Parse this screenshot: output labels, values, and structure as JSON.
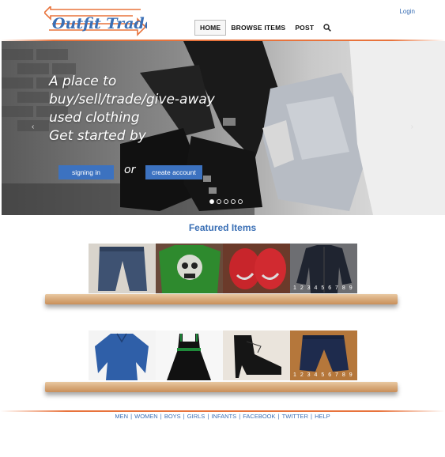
{
  "header": {
    "logo_text": "Outfit Trader",
    "nav": [
      "HOME",
      "BROWSE ITEMS",
      "POST"
    ],
    "login": "Login"
  },
  "hero": {
    "lines": [
      "A place to",
      "buy/sell/trade/give-away",
      "used clothing",
      "Get started by"
    ],
    "signin_label": "signing in",
    "or_text": "or",
    "create_label": "create account",
    "slide_count": 5,
    "active_slide": 0
  },
  "featured": {
    "title": "Featured Items",
    "row1": [
      {
        "name": "jeans",
        "icon": "jeans"
      },
      {
        "name": "green skull shirt",
        "icon": "skull-shirt"
      },
      {
        "name": "red sneakers",
        "icon": "sneakers"
      },
      {
        "name": "black jacket",
        "icon": "jacket",
        "pager": "1 2 3 4 5 6 7 8 9"
      }
    ],
    "row2": [
      {
        "name": "blue blouse",
        "icon": "blouse"
      },
      {
        "name": "black dress",
        "icon": "dress"
      },
      {
        "name": "black booties",
        "icon": "booties"
      },
      {
        "name": "capri jeans",
        "icon": "capris",
        "pager": "1 2 3 4 5 6 7 8 9"
      }
    ]
  },
  "footer": {
    "links": [
      "MEN",
      "WOMEN",
      "BOYS",
      "GIRLS",
      "INFANTS",
      "FACEBOOK",
      "TWITTER",
      "HELP"
    ]
  },
  "colors": {
    "accent_orange": "#e8733c",
    "link_blue": "#3a6fb5",
    "button_blue": "#3c72c0"
  }
}
